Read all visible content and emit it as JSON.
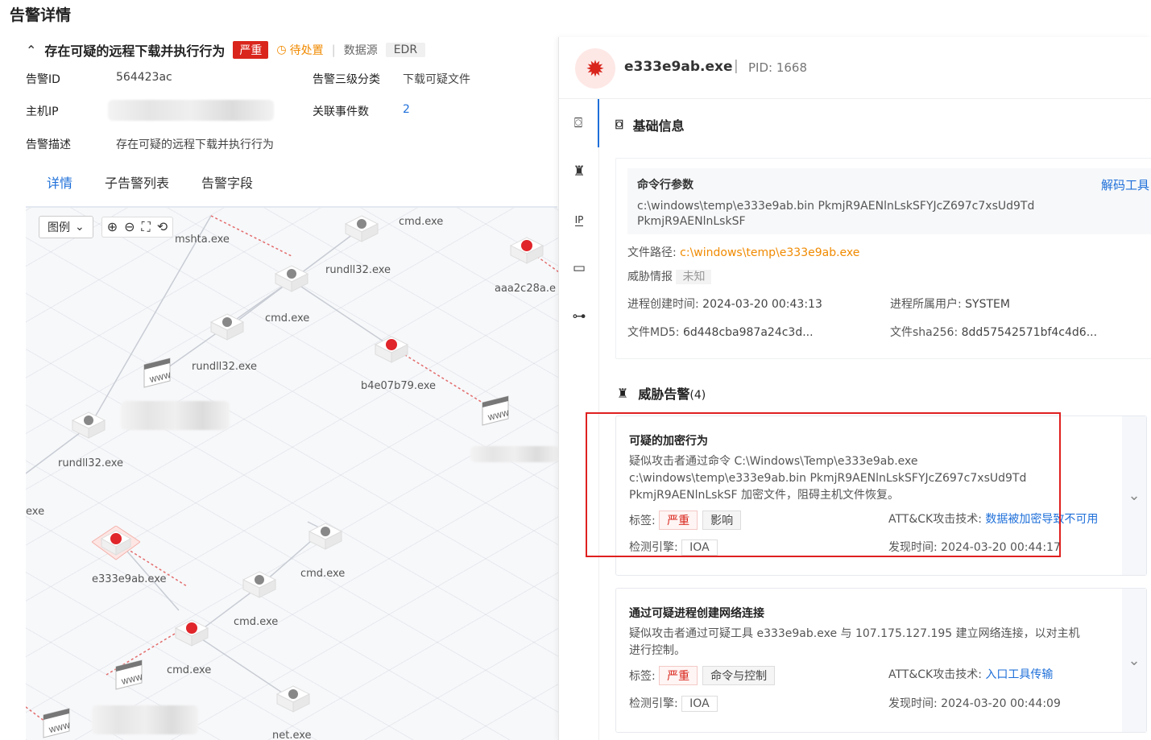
{
  "page_title": "告警详情",
  "alert": {
    "title": "存在可疑的远程下载并执行行为",
    "severity": "严重",
    "status": "待处置",
    "source_label": "数据源",
    "source": "EDR",
    "fields": {
      "alert_id_label": "告警ID",
      "alert_id": "564423ac",
      "class3_label": "告警三级分类",
      "class3": "下载可疑文件",
      "host_ip_label": "主机IP",
      "related_label": "关联事件数",
      "related": "2",
      "desc_label": "告警描述",
      "desc": "存在可疑的远程下载并执行行为"
    }
  },
  "tabs": [
    "详情",
    "子告警列表",
    "告警字段"
  ],
  "graph": {
    "legend_label": "图例",
    "nodes": [
      "mshta.exe",
      "cmd.exe",
      "rundll32.exe",
      "aaa2c28a.e",
      "cmd.exe",
      "rundll32.exe",
      "b4e07b79.exe",
      "rundll32.exe",
      "exe",
      "e333e9ab.exe",
      "cmd.exe",
      "cmd.exe",
      "cmd.exe",
      "net.exe"
    ]
  },
  "panel": {
    "proc_name": "e333e9ab.exe",
    "pid": "PID: 1668",
    "basic_title": "基础信息",
    "cmd_label": "命令行参数",
    "decode_tool": "解码工具",
    "cmd_line1": "c:\\windows\\temp\\e333e9ab.bin PkmjR9AENlnLskSFYJcZ697c7xsUd9Td",
    "cmd_line2": "PkmjR9AENlnLskSF",
    "path_label": "文件路径:",
    "path": "c:\\windows\\temp\\e333e9ab.exe",
    "intel_label": "威胁情报",
    "intel": "未知",
    "ctime_label": "进程创建时间:",
    "ctime": "2024-03-20 00:43:13",
    "user_label": "进程所属用户:",
    "user": "SYSTEM",
    "md5_label": "文件MD5:",
    "md5": "6d448cba987a24c3d...",
    "sha_label": "文件sha256:",
    "sha": "8dd57542571bf4c4d6...",
    "threat_title": "威胁告警",
    "threat_count": "(4)",
    "cards": [
      {
        "title": "可疑的加密行为",
        "desc": "疑似攻击者通过命令 C:\\Windows\\Temp\\e333e9ab.exe c:\\windows\\temp\\e333e9ab.bin PkmjR9AENlnLskSFYJcZ697c7xsUd9Td PkmjR9AENlnLskSF 加密文件，阻碍主机文件恢复。",
        "tag_label": "标签:",
        "tags": [
          "严重",
          "影响"
        ],
        "attck_label": "ATT&CK攻击技术:",
        "attck": "数据被加密导致不可用",
        "engine_label": "检测引擎:",
        "engine": "IOA",
        "found_label": "发现时间:",
        "found": "2024-03-20 00:44:17"
      },
      {
        "title": "通过可疑进程创建网络连接",
        "desc": "疑似攻击者通过可疑工具 e333e9ab.exe 与 107.175.127.195 建立网络连接，以对主机进行控制。",
        "tag_label": "标签:",
        "tags": [
          "严重",
          "命令与控制"
        ],
        "attck_label": "ATT&CK攻击技术:",
        "attck": "入口工具传输",
        "engine_label": "检测引擎:",
        "engine": "IOA",
        "found_label": "发现时间:",
        "found": "2024-03-20 00:44:09"
      }
    ]
  }
}
